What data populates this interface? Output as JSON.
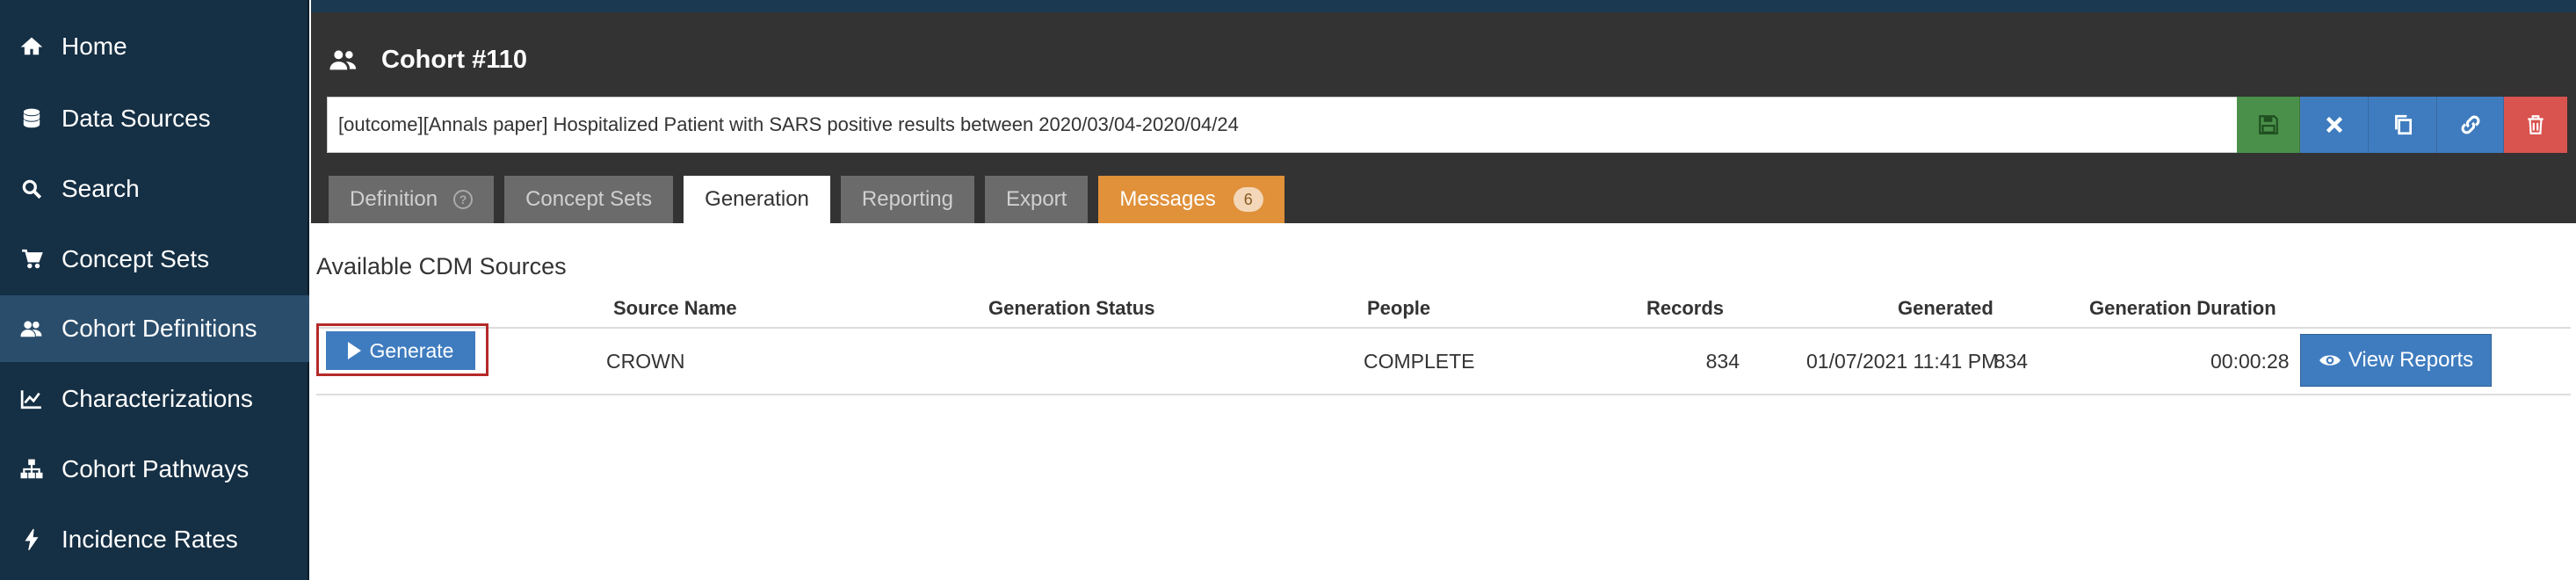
{
  "sidebar": {
    "items": [
      {
        "label": "Home",
        "icon": "home-icon"
      },
      {
        "label": "Data Sources",
        "icon": "database-icon"
      },
      {
        "label": "Search",
        "icon": "search-icon"
      },
      {
        "label": "Concept Sets",
        "icon": "shopping-cart-icon"
      },
      {
        "label": "Cohort Definitions",
        "icon": "users-icon",
        "active": true
      },
      {
        "label": "Characterizations",
        "icon": "line-chart-icon"
      },
      {
        "label": "Cohort Pathways",
        "icon": "sitemap-icon"
      },
      {
        "label": "Incidence Rates",
        "icon": "bolt-icon"
      }
    ]
  },
  "header": {
    "title": "Cohort #110",
    "name_value": "[outcome][Annals paper] Hospitalized Patient with SARS positive results between 2020/03/04-2020/04/24",
    "buttons": [
      "save-icon",
      "close-icon",
      "copy-icon",
      "link-icon",
      "trash-icon"
    ],
    "colors": {
      "save": "#4a8f4a",
      "action": "#3f7cbf",
      "delete": "#d9534f"
    }
  },
  "tabs": [
    {
      "label": "Definition"
    },
    {
      "label": "Concept Sets"
    },
    {
      "label": "Generation",
      "active": true
    },
    {
      "label": "Reporting"
    },
    {
      "label": "Export"
    },
    {
      "label": "Messages",
      "badge": "6"
    }
  ],
  "content": {
    "section_title": "Available CDM Sources",
    "columns": [
      "Source Name",
      "Generation Status",
      "People",
      "Records",
      "Generated",
      "Generation Duration"
    ],
    "rows": [
      {
        "generate_label": "Generate",
        "source_name": "CROWN",
        "status": "COMPLETE",
        "people": "834",
        "records": "834",
        "generated": "01/07/2021 11:41 PM",
        "duration": "00:00:28",
        "view_label": "View Reports"
      }
    ]
  }
}
